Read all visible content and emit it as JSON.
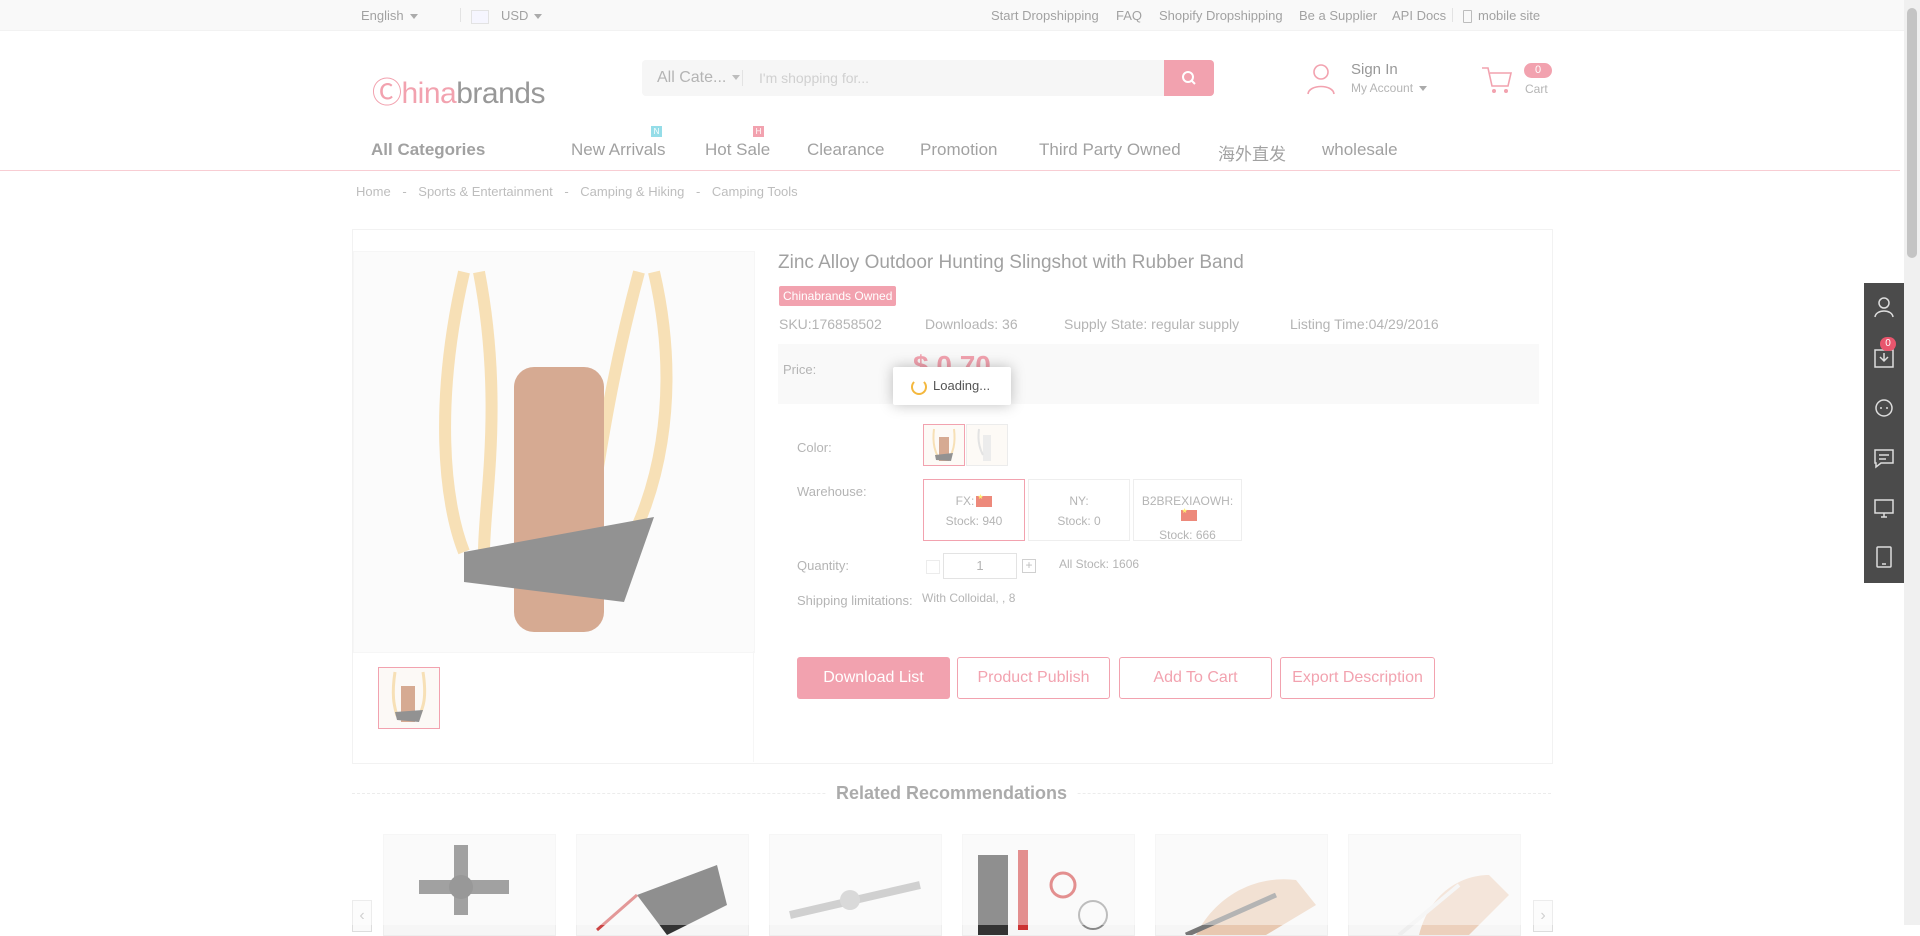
{
  "topbar": {
    "language": "English",
    "currency": "USD",
    "links": [
      "Start Dropshipping",
      "FAQ",
      "Shopify Dropshipping",
      "Be a Supplier",
      "API Docs"
    ],
    "mobile_site": "mobile site"
  },
  "header": {
    "logo_part1": "Ⓒhina",
    "logo_part2": "brands",
    "category_select": "All Cate...",
    "search_placeholder": "I'm shopping for...",
    "sign_in": "Sign In",
    "my_account": "My Account",
    "cart_label": "Cart",
    "cart_count": "0"
  },
  "nav": {
    "all_categories": "All Categories",
    "items": [
      "New Arrivals",
      "Hot Sale",
      "Clearance",
      "Promotion",
      "Third Party Owned",
      "海外直发",
      "wholesale"
    ],
    "new_tag": "N",
    "hot_tag": "H"
  },
  "breadcrumb": [
    "Home",
    "-",
    "Sports & Entertainment",
    "-",
    "Camping & Hiking",
    "-",
    "Camping Tools"
  ],
  "product": {
    "title": "Zinc Alloy Outdoor Hunting Slingshot with Rubber Band",
    "badge": "Chinabrands Owned",
    "sku": "SKU:176858502",
    "downloads": "Downloads: 36",
    "supply_state": "Supply State: regular supply",
    "listing_time": "Listing Time:04/29/2016",
    "price_label": "Price:",
    "price": "$ 0.70",
    "color_label": "Color:",
    "warehouse_label": "Warehouse:",
    "warehouses": [
      {
        "name": "FX:",
        "stock": "Stock: 940",
        "flag": true
      },
      {
        "name": "NY:",
        "stock": "Stock: 0",
        "flag": false
      },
      {
        "name": "B2BREXIAOWH:",
        "stock": "Stock: 666",
        "flag": true
      }
    ],
    "quantity_label": "Quantity:",
    "quantity": "1",
    "all_stock": "All Stock: 1606",
    "shipping_label": "Shipping limitations:",
    "shipping_value": "With Colloidal,  ,  8"
  },
  "buttons": {
    "download_list": "Download List",
    "product_publish": "Product Publish",
    "add_to_cart": "Add To Cart",
    "export_description": "Export Description"
  },
  "related": {
    "title": "Related Recommendations"
  },
  "loading_text": "Loading...",
  "sidebar": {
    "download_count": "0"
  },
  "colors": {
    "accent": "#e8566d",
    "sidebar": "#4b4b4b"
  }
}
